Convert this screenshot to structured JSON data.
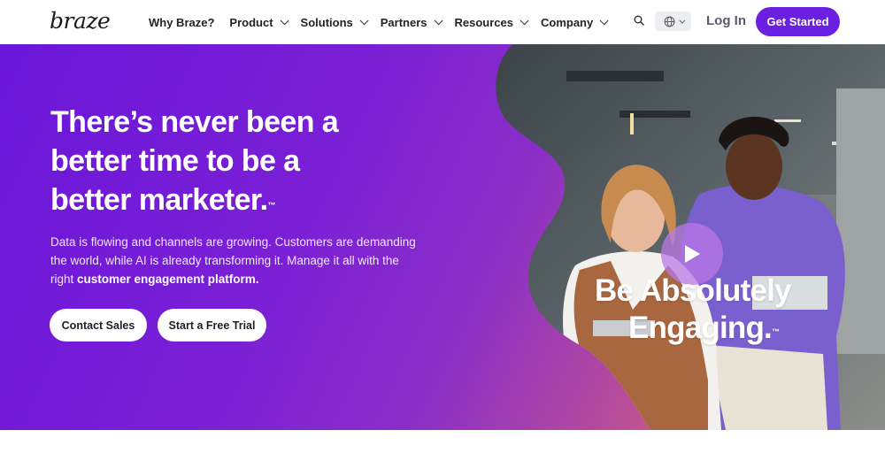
{
  "brand": {
    "logo_text": "braze",
    "accent": "#6b1fe0"
  },
  "nav": {
    "items": [
      {
        "label": "Why Braze?",
        "has_dropdown": false
      },
      {
        "label": "Product",
        "has_dropdown": true
      },
      {
        "label": "Solutions",
        "has_dropdown": true
      },
      {
        "label": "Partners",
        "has_dropdown": true
      },
      {
        "label": "Resources",
        "has_dropdown": true
      },
      {
        "label": "Company",
        "has_dropdown": true
      }
    ],
    "search_icon": "search-icon",
    "language_icon": "globe-icon",
    "login_label": "Log In",
    "cta_label": "Get Started"
  },
  "hero": {
    "title_lines": [
      "There’s never been a",
      "better time to be a",
      "better marketer."
    ],
    "title_tm": "™",
    "description_pre": "Data is flowing and channels are growing. Customers are demanding the world, while AI is already transforming it. Manage it all with the right ",
    "description_bold": "customer engagement platform.",
    "buttons": {
      "contact": "Contact Sales",
      "trial": "Start a Free Trial"
    },
    "video": {
      "overlay_line1": "Be Absolutely",
      "overlay_line2": "Engaging.",
      "overlay_tm": "™",
      "play_icon": "play-icon"
    }
  }
}
